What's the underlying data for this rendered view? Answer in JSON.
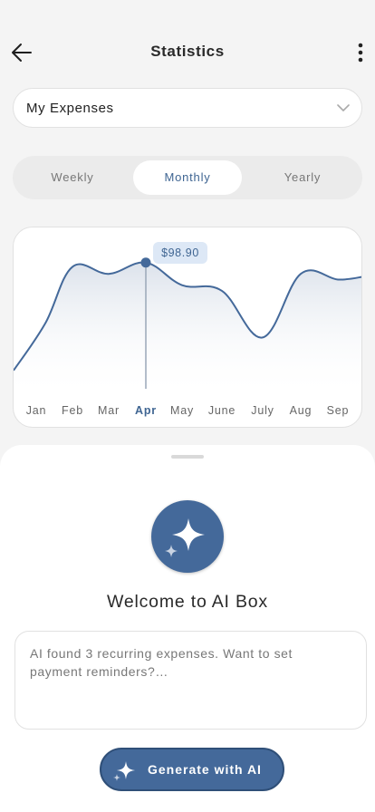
{
  "header": {
    "title": "Statistics",
    "back_icon": "arrow-left-icon",
    "more_icon": "more-vertical-icon"
  },
  "dropdown": {
    "selected": "My Expenses",
    "icon": "chevron-down-icon"
  },
  "period_tabs": {
    "items": [
      "Weekly",
      "Monthly",
      "Yearly"
    ],
    "active": "Monthly"
  },
  "chart_data": {
    "type": "line",
    "categories": [
      "Jan",
      "Feb",
      "Mar",
      "Apr",
      "May",
      "June",
      "July",
      "Aug",
      "Sep"
    ],
    "highlighted": "Apr",
    "tooltip_value": "$98.90",
    "series": [
      {
        "values": [
          45,
          85,
          80,
          88,
          72,
          68,
          35,
          80,
          76
        ]
      }
    ],
    "ylim": [
      0,
      100
    ],
    "grid": false,
    "legend": "none"
  },
  "sheet": {
    "welcome": "Welcome to AI Box",
    "badge_icon": "sparkle-icon",
    "prompt": "AI found 3 recurring expenses. Want to set payment reminders?…",
    "button_label": "Generate with AI",
    "button_icon": "sparkle-icon"
  },
  "colors": {
    "accent": "#44699a",
    "accent_text": "#3f6592",
    "tooltip_bg": "#dde8f6",
    "background": "#f4f4f4"
  }
}
